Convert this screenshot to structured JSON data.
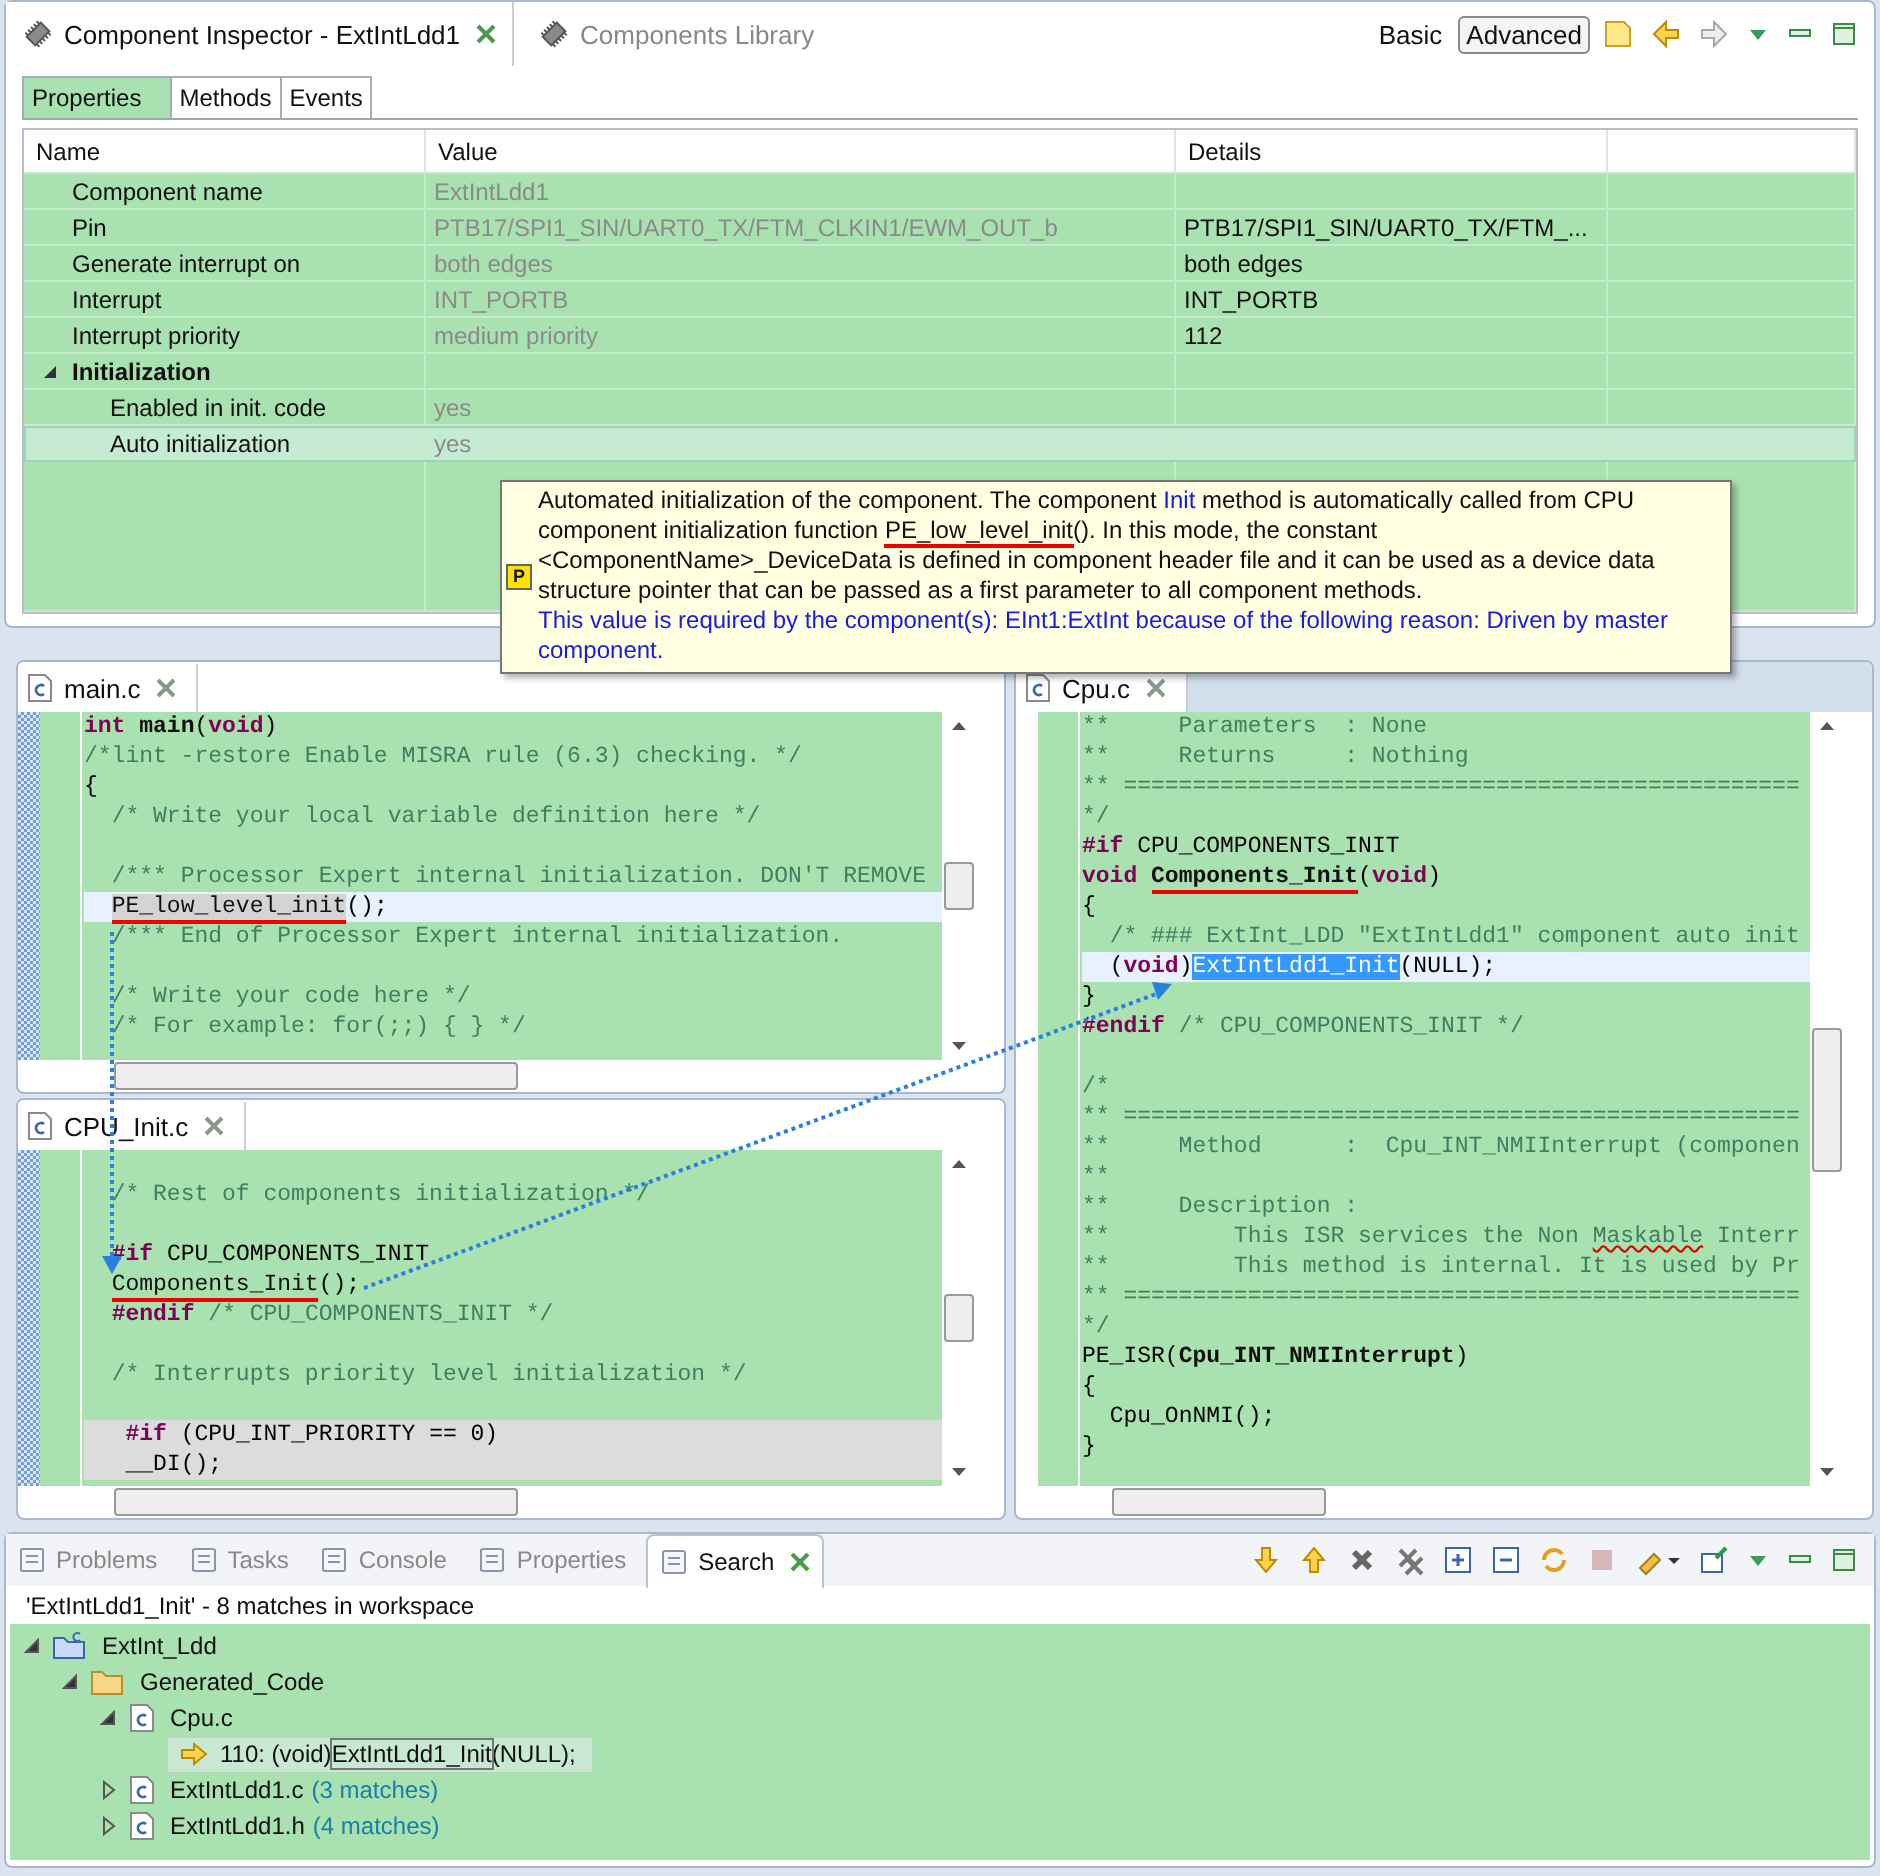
{
  "inspector": {
    "tabs": [
      {
        "label": "Component Inspector - ExtIntLdd1",
        "selected": true
      },
      {
        "label": "Components Library",
        "selected": false
      }
    ],
    "modes": [
      {
        "label": "Basic",
        "selected": false
      },
      {
        "label": "Advanced",
        "selected": true
      }
    ],
    "subtabs": [
      {
        "label": "Properties",
        "selected": true
      },
      {
        "label": "Methods",
        "selected": false
      },
      {
        "label": "Events",
        "selected": false
      }
    ],
    "columns": [
      "Name",
      "Value",
      "Details"
    ],
    "rows": [
      {
        "name": "Component name",
        "value": "ExtIntLdd1",
        "selected": false
      },
      {
        "name": "Pin",
        "value": "PTB17/SPI1_SIN/UART0_TX/FTM_CLKIN1/EWM_OUT_b",
        "details": "PTB17/SPI1_SIN/UART0_TX/FTM_...",
        "selected": false
      },
      {
        "name": "Generate interrupt on",
        "value": "both edges",
        "details": "both edges",
        "selected": false
      },
      {
        "name": "Interrupt",
        "value": "INT_PORTB",
        "details": "INT_PORTB",
        "selected": false
      },
      {
        "name": "Interrupt priority",
        "value": "medium priority",
        "details": "112",
        "selected": false
      },
      {
        "name": "Initialization",
        "expanded": true,
        "selected": false,
        "children": [
          {
            "name": "Enabled in init. code",
            "value": "yes",
            "selected": false
          },
          {
            "name": "Auto initialization",
            "value": "yes",
            "selected": true
          }
        ]
      }
    ]
  },
  "tooltip": {
    "badge": "P",
    "paragraph": [
      {
        "kind": "plain",
        "text": "Automated initialization of the component. The component "
      },
      {
        "kind": "link",
        "text": "Init"
      },
      {
        "kind": "plain",
        "text": " method is automatically called from CPU component initialization function "
      },
      {
        "kind": "underlined",
        "text": "PE_low_level_init"
      },
      {
        "kind": "plain",
        "text": "(). In this mode, the constant <ComponentName>_DeviceData is defined in component header file and it can be used as a device data structure pointer that can be passed as a first parameter to all component methods."
      }
    ],
    "note": "This value is required by the component(s): EInt1:ExtInt because of the following reason: Driven by master component."
  },
  "editors": [
    {
      "title": "main.c",
      "selected": false,
      "lines": [
        {
          "kind": "normal",
          "tokens": [
            {
              "kind": "keyword",
              "text": "int"
            },
            {
              "kind": "bold",
              "text": " main"
            },
            {
              "kind": "plain",
              "text": "("
            },
            {
              "kind": "keyword",
              "text": "void"
            },
            {
              "kind": "plain",
              "text": ")"
            }
          ]
        },
        {
          "kind": "normal",
          "tokens": [
            {
              "kind": "comment",
              "text": "/*lint -restore Enable MISRA rule (6.3) checking. */"
            }
          ]
        },
        {
          "kind": "normal",
          "tokens": [
            {
              "kind": "plain",
              "text": "{"
            }
          ]
        },
        {
          "kind": "normal",
          "tokens": [
            {
              "kind": "comment",
              "text": "  /* Write your local variable definition here */"
            }
          ]
        },
        {
          "kind": "blank"
        },
        {
          "kind": "normal",
          "tokens": [
            {
              "kind": "comment",
              "text": "  /*** Processor Expert internal initialization. DON'T REMOVE"
            }
          ]
        },
        {
          "kind": "current",
          "tokens": [
            {
              "kind": "occurrence",
              "text": "  PE_low_level_init"
            },
            {
              "kind": "plain",
              "text": "();"
            }
          ]
        },
        {
          "kind": "normal",
          "tokens": [
            {
              "kind": "comment",
              "text": "  /*** End of Processor Expert internal initialization."
            }
          ]
        },
        {
          "kind": "blank"
        },
        {
          "kind": "normal",
          "tokens": [
            {
              "kind": "comment",
              "text": "  /* Write your code here */"
            }
          ]
        },
        {
          "kind": "normal",
          "tokens": [
            {
              "kind": "comment",
              "text": "  /* For example: for(;;) { } */"
            }
          ]
        }
      ]
    },
    {
      "title": "CPU_Init.c",
      "selected": false,
      "lines": [
        {
          "kind": "blank"
        },
        {
          "kind": "normal",
          "tokens": [
            {
              "kind": "comment",
              "text": "  /* Rest of components initialization */"
            }
          ]
        },
        {
          "kind": "blank"
        },
        {
          "kind": "normal",
          "tokens": [
            {
              "kind": "keyword",
              "text": "  #if"
            },
            {
              "kind": "plain",
              "text": " CPU_COMPONENTS_INIT"
            }
          ]
        },
        {
          "kind": "normal",
          "tokens": [
            {
              "kind": "underlined",
              "text": "  Components_Init"
            },
            {
              "kind": "plain",
              "text": "();"
            }
          ]
        },
        {
          "kind": "normal",
          "tokens": [
            {
              "kind": "keyword",
              "text": "  #endif"
            },
            {
              "kind": "comment",
              "text": " /* CPU_COMPONENTS_INIT */"
            }
          ]
        },
        {
          "kind": "blank"
        },
        {
          "kind": "normal",
          "tokens": [
            {
              "kind": "comment",
              "text": "  /* Interrupts priority level initialization */"
            }
          ]
        },
        {
          "kind": "blank"
        },
        {
          "kind": "inactive",
          "tokens": [
            {
              "kind": "keyword",
              "text": "   #if"
            },
            {
              "kind": "plain",
              "text": " (CPU_INT_PRIORITY == 0)"
            }
          ]
        },
        {
          "kind": "inactive",
          "tokens": [
            {
              "kind": "plain",
              "text": "   __DI();"
            }
          ]
        }
      ]
    },
    {
      "title": "Cpu.c",
      "selected": true,
      "lines": [
        {
          "kind": "normal",
          "tokens": [
            {
              "kind": "comment",
              "text": "**     Parameters  : None"
            }
          ]
        },
        {
          "kind": "normal",
          "tokens": [
            {
              "kind": "comment",
              "text": "**     Returns     : Nothing"
            }
          ]
        },
        {
          "kind": "normal",
          "tokens": [
            {
              "kind": "comment",
              "text": "** ================================================="
            }
          ]
        },
        {
          "kind": "normal",
          "tokens": [
            {
              "kind": "comment",
              "text": "*/"
            }
          ]
        },
        {
          "kind": "normal",
          "tokens": [
            {
              "kind": "keyword",
              "text": "#if"
            },
            {
              "kind": "plain",
              "text": " CPU_COMPONENTS_INIT"
            }
          ]
        },
        {
          "kind": "normal",
          "tokens": [
            {
              "kind": "keyword",
              "text": "void"
            },
            {
              "kind": "bold-underlined",
              "text": " Components_Init"
            },
            {
              "kind": "plain",
              "text": "("
            },
            {
              "kind": "keyword",
              "text": "void"
            },
            {
              "kind": "plain",
              "text": ")"
            }
          ]
        },
        {
          "kind": "normal",
          "tokens": [
            {
              "kind": "plain",
              "text": "{"
            }
          ]
        },
        {
          "kind": "normal",
          "tokens": [
            {
              "kind": "comment",
              "text": "  /* ### ExtInt_LDD \"ExtIntLdd1\" component auto init"
            }
          ]
        },
        {
          "kind": "current",
          "tokens": [
            {
              "kind": "plain",
              "text": "  ("
            },
            {
              "kind": "keyword",
              "text": "void"
            },
            {
              "kind": "plain",
              "text": ")"
            },
            {
              "kind": "selected",
              "text": "ExtIntLdd1_Init"
            },
            {
              "kind": "plain",
              "text": "(NULL);"
            }
          ]
        },
        {
          "kind": "normal",
          "tokens": [
            {
              "kind": "plain",
              "text": "}"
            }
          ]
        },
        {
          "kind": "normal",
          "tokens": [
            {
              "kind": "keyword",
              "text": "#endif"
            },
            {
              "kind": "comment",
              "text": " /* CPU_COMPONENTS_INIT */"
            }
          ]
        },
        {
          "kind": "blank"
        },
        {
          "kind": "normal",
          "tokens": [
            {
              "kind": "comment",
              "text": "/*"
            }
          ]
        },
        {
          "kind": "normal",
          "tokens": [
            {
              "kind": "comment",
              "text": "** ================================================="
            }
          ]
        },
        {
          "kind": "normal",
          "tokens": [
            {
              "kind": "comment",
              "text": "**     Method      :  Cpu_INT_NMIInterrupt (componen"
            }
          ]
        },
        {
          "kind": "normal",
          "tokens": [
            {
              "kind": "comment",
              "text": "**"
            }
          ]
        },
        {
          "kind": "normal",
          "tokens": [
            {
              "kind": "comment",
              "text": "**     Description :"
            }
          ]
        },
        {
          "kind": "normal",
          "tokens": [
            {
              "kind": "comment",
              "text": "**         This ISR services the Non "
            },
            {
              "kind": "misspelled",
              "text": "Maskable"
            },
            {
              "kind": "comment",
              "text": " Interr"
            }
          ]
        },
        {
          "kind": "normal",
          "tokens": [
            {
              "kind": "comment",
              "text": "**         This method is internal. It is used by Pr"
            }
          ]
        },
        {
          "kind": "normal",
          "tokens": [
            {
              "kind": "comment",
              "text": "** ================================================="
            }
          ]
        },
        {
          "kind": "normal",
          "tokens": [
            {
              "kind": "comment",
              "text": "*/"
            }
          ]
        },
        {
          "kind": "normal",
          "tokens": [
            {
              "kind": "plain",
              "text": "PE_ISR("
            },
            {
              "kind": "bold",
              "text": "Cpu_INT_NMIInterrupt"
            },
            {
              "kind": "plain",
              "text": ")"
            }
          ]
        },
        {
          "kind": "normal",
          "tokens": [
            {
              "kind": "plain",
              "text": "{"
            }
          ]
        },
        {
          "kind": "normal",
          "tokens": [
            {
              "kind": "plain",
              "text": "  Cpu_OnNMI();"
            }
          ]
        },
        {
          "kind": "normal",
          "tokens": [
            {
              "kind": "plain",
              "text": "}"
            }
          ]
        }
      ]
    }
  ],
  "search": {
    "tabs": [
      {
        "label": "Problems",
        "selected": false
      },
      {
        "label": "Tasks",
        "selected": false
      },
      {
        "label": "Console",
        "selected": false
      },
      {
        "label": "Properties",
        "selected": false
      },
      {
        "label": "Search",
        "selected": true
      }
    ],
    "summary": "'ExtIntLdd1_Init' - 8 matches in workspace",
    "tree": [
      {
        "kind": "project",
        "label": "ExtInt_Ldd",
        "expanded": true,
        "selected": false,
        "children": [
          {
            "kind": "folder",
            "label": "Generated_Code",
            "expanded": true,
            "selected": false,
            "children": [
              {
                "kind": "file",
                "label": "Cpu.c",
                "expanded": true,
                "selected": false,
                "children": [
                  {
                    "kind": "match",
                    "label": "110: (void)",
                    "hit": "ExtIntLdd1_Init",
                    "after": "(NULL);",
                    "selected": true
                  }
                ]
              },
              {
                "kind": "file",
                "label": "ExtIntLdd1.c",
                "count": "(3 matches)",
                "expanded": false,
                "selected": false
              },
              {
                "kind": "file",
                "label": "ExtIntLdd1.h",
                "count": "(4 matches)",
                "expanded": false,
                "selected": false
              }
            ]
          }
        ]
      }
    ]
  }
}
